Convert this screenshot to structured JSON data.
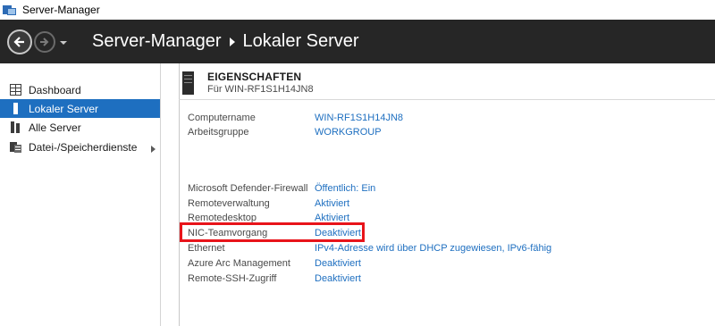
{
  "window": {
    "title": "Server-Manager"
  },
  "header": {
    "breadcrumb_root": "Server-Manager",
    "breadcrumb_current": "Lokaler Server"
  },
  "sidebar": {
    "items": [
      {
        "label": "Dashboard",
        "icon": "dashboard-icon"
      },
      {
        "label": "Lokaler Server",
        "icon": "local-server-icon",
        "selected": true
      },
      {
        "label": "Alle Server",
        "icon": "all-servers-icon"
      },
      {
        "label": "Datei-/Speicherdienste",
        "icon": "file-storage-icon",
        "has_submenu": true
      }
    ]
  },
  "properties": {
    "title": "EIGENSCHAFTEN",
    "subtitle": "Für WIN-RF1S1H14JN8",
    "rows": [
      {
        "label": "Computername",
        "value": "WIN-RF1S1H14JN8"
      },
      {
        "label": "Arbeitsgruppe",
        "value": "WORKGROUP"
      },
      {
        "label": "Microsoft Defender-Firewall",
        "value": "Öffentlich: Ein"
      },
      {
        "label": "Remoteverwaltung",
        "value": "Aktiviert"
      },
      {
        "label": "Remotedesktop",
        "value": "Aktiviert"
      },
      {
        "label": "NIC-Teamvorgang",
        "value": "Deaktiviert",
        "highlighted": true
      },
      {
        "label": "Ethernet",
        "value": "IPv4-Adresse wird über DHCP zugewiesen, IPv6-fähig"
      },
      {
        "label": "Azure Arc Management",
        "value": "Deaktiviert"
      },
      {
        "label": "Remote-SSH-Zugriff",
        "value": "Deaktiviert"
      }
    ]
  },
  "colors": {
    "header_bg": "#262626",
    "selection": "#1e6fc0",
    "link": "#1e6fc0",
    "highlight_box": "#e8141a"
  }
}
